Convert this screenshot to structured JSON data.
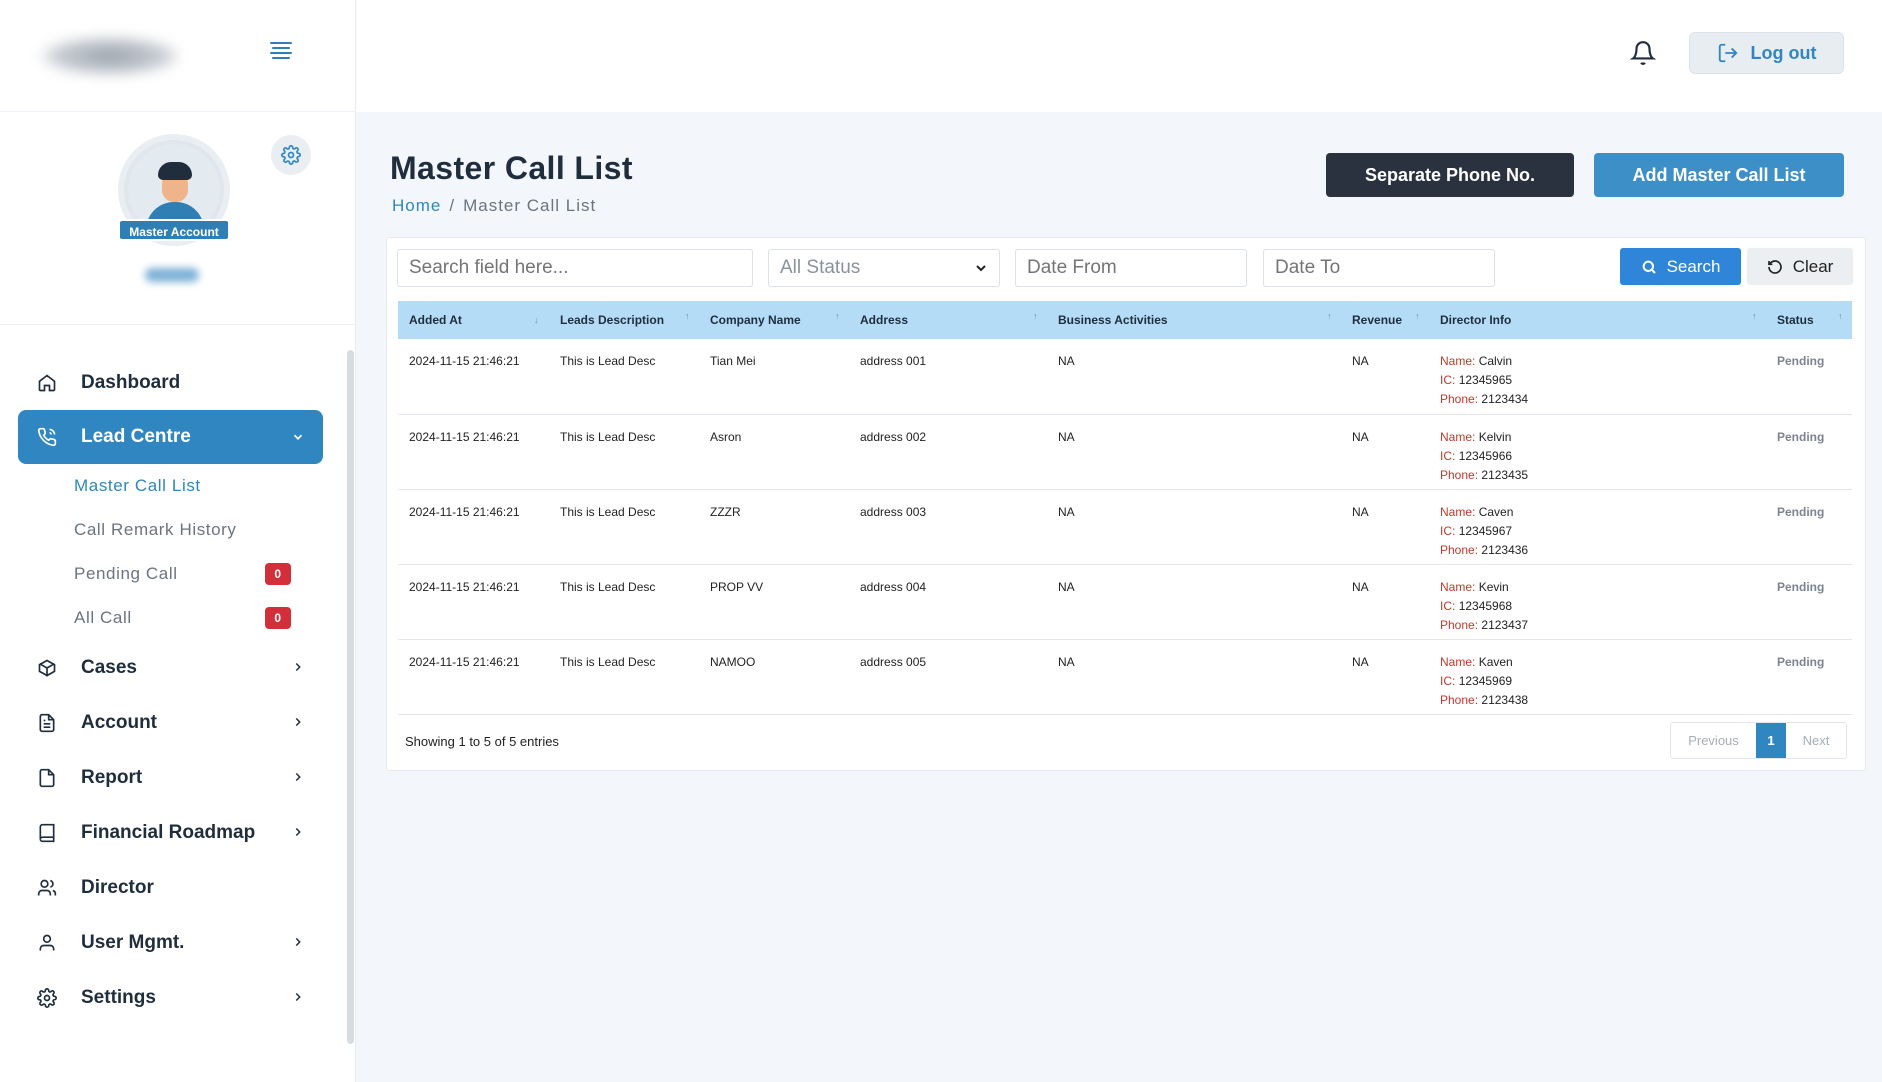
{
  "sidebar": {
    "profile_badge": "Master Account",
    "items": [
      {
        "label": "Dashboard"
      },
      {
        "label": "Lead Centre",
        "subitems": [
          {
            "label": "Master Call List"
          },
          {
            "label": "Call Remark History"
          },
          {
            "label": "Pending Call",
            "count": "0"
          },
          {
            "label": "All Call",
            "count": "0"
          }
        ]
      },
      {
        "label": "Cases"
      },
      {
        "label": "Account"
      },
      {
        "label": "Report"
      },
      {
        "label": "Financial Roadmap"
      },
      {
        "label": "Director"
      },
      {
        "label": "User Mgmt."
      },
      {
        "label": "Settings"
      }
    ]
  },
  "topbar": {
    "logout_label": "Log out"
  },
  "page": {
    "title": "Master Call List",
    "breadcrumb": {
      "home": "Home",
      "sep": "/",
      "current": "Master Call List"
    },
    "btn_separate": "Separate Phone No.",
    "btn_add": "Add Master Call List"
  },
  "filters": {
    "search_placeholder": "Search field here...",
    "status_value": "All Status",
    "date_from_placeholder": "Date From",
    "date_to_placeholder": "Date To",
    "search_label": "Search",
    "clear_label": "Clear"
  },
  "table": {
    "columns": [
      "Added At",
      "Leads Description",
      "Company Name",
      "Address",
      "Business Activities",
      "Revenue",
      "Director Info",
      "Status"
    ],
    "label_name": "Name:",
    "label_ic": "IC:",
    "label_phone": "Phone:",
    "rows": [
      {
        "added": "2024-11-15 21:46:21",
        "desc": "This is Lead Desc",
        "company": "Tian Mei",
        "address": "address 001",
        "business": "NA",
        "revenue": "NA",
        "name": "Calvin",
        "ic": "12345965",
        "phone": "2123434",
        "status": "Pending"
      },
      {
        "added": "2024-11-15 21:46:21",
        "desc": "This is Lead Desc",
        "company": "Asron",
        "address": "address 002",
        "business": "NA",
        "revenue": "NA",
        "name": "Kelvin",
        "ic": "12345966",
        "phone": "2123435",
        "status": "Pending"
      },
      {
        "added": "2024-11-15 21:46:21",
        "desc": "This is Lead Desc",
        "company": "ZZZR",
        "address": "address 003",
        "business": "NA",
        "revenue": "NA",
        "name": "Caven",
        "ic": "12345967",
        "phone": "2123436",
        "status": "Pending"
      },
      {
        "added": "2024-11-15 21:46:21",
        "desc": "This is Lead Desc",
        "company": "PROP VV",
        "address": "address 004",
        "business": "NA",
        "revenue": "NA",
        "name": "Kevin",
        "ic": "12345968",
        "phone": "2123437",
        "status": "Pending"
      },
      {
        "added": "2024-11-15 21:46:21",
        "desc": "This is Lead Desc",
        "company": "NAMOO",
        "address": "address 005",
        "business": "NA",
        "revenue": "NA",
        "name": "Kaven",
        "ic": "12345969",
        "phone": "2123438",
        "status": "Pending"
      }
    ]
  },
  "pagination": {
    "info": "Showing 1 to 5 of 5 entries",
    "previous": "Previous",
    "page": "1",
    "next": "Next"
  },
  "colors": {
    "accent": "#2f86c1",
    "dark_button": "#2a3240",
    "badge_red": "#d32f3a",
    "header_row": "#b5dcf7"
  }
}
